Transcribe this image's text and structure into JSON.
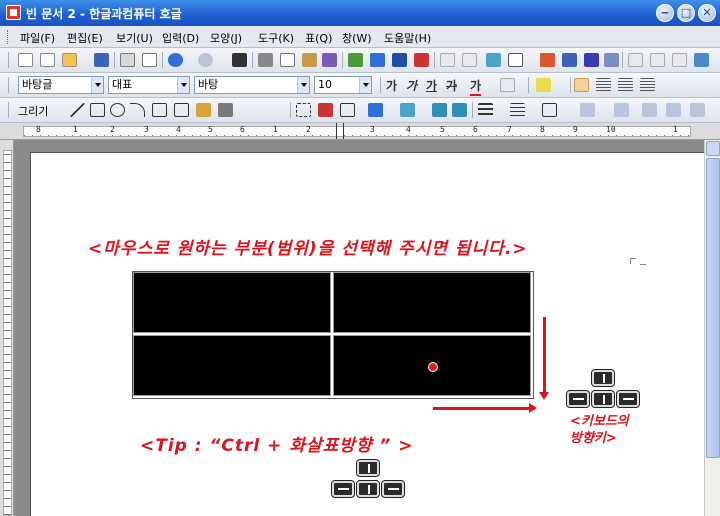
{
  "window": {
    "title": "빈 문서 2 - 한글과컴퓨터 호글",
    "min_label": "‒",
    "max_label": "□",
    "close_label": "✕"
  },
  "menu": [
    {
      "label": "파일(F)"
    },
    {
      "label": "편집(E)"
    },
    {
      "label": "보기(U)"
    },
    {
      "label": "입력(D)"
    },
    {
      "label": "모양(J)"
    },
    {
      "label": "도구(K)"
    },
    {
      "label": "표(Q)"
    },
    {
      "label": "창(W)"
    },
    {
      "label": "도움말(H)"
    }
  ],
  "format_toolbar": {
    "style_combo": "바탕글",
    "lang_combo": "대표",
    "font_combo": "바탕",
    "size_combo": "10",
    "bold": "가",
    "italic": "가",
    "underline": "가",
    "strike": "가",
    "color": "가"
  },
  "draw_toolbar": {
    "draw_label": "그리기"
  },
  "ruler": {
    "ticks": [
      "8",
      "1",
      "2",
      "3",
      "4",
      "5",
      "6",
      "1",
      "2",
      "3",
      "4",
      "5",
      "6",
      "7",
      "8",
      "9",
      "10",
      "1"
    ]
  },
  "document": {
    "headline": "<마우스로 원하는 부분(범위)을 선택해 주시면 됩니다.>",
    "key_caption_line1": "<키보드의",
    "key_caption_line2": "방향키>",
    "tip": "<Tip : “Ctrl + 화살표방향 ” >"
  },
  "colors": {
    "annotation": "#e0121a",
    "title_bar": "#1c5fd0",
    "table_cell": "#000000"
  }
}
